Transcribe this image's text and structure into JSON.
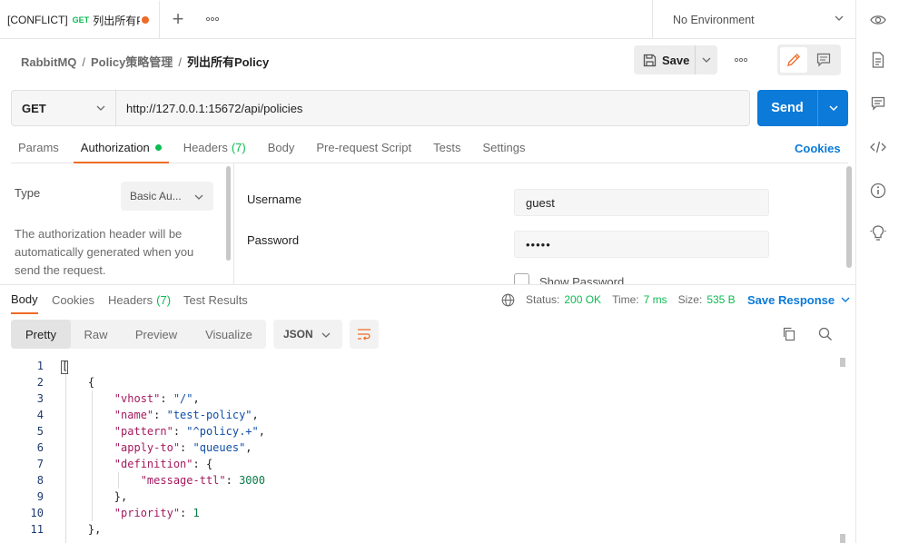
{
  "tab": {
    "name": "[CONFLICT]",
    "method": "GET",
    "title": "列出所有Policy",
    "new_tab_symbol": "+",
    "more_symbol": "ooo"
  },
  "environment": {
    "selected": "No Environment"
  },
  "breadcrumb": {
    "items": [
      "RabbitMQ",
      "Policy策略管理"
    ],
    "current": "列出所有Policy",
    "separator": "/"
  },
  "toolbar": {
    "save_label": "Save",
    "more_symbol": "ooo"
  },
  "request": {
    "method": "GET",
    "url": "http://127.0.0.1:15672/api/policies",
    "send_label": "Send"
  },
  "request_tabs": {
    "params": "Params",
    "authorization": "Authorization",
    "headers": "Headers",
    "headers_count": "(7)",
    "body": "Body",
    "prerequest": "Pre-request Script",
    "tests": "Tests",
    "settings": "Settings",
    "cookies": "Cookies"
  },
  "auth": {
    "type_label": "Type",
    "type_value": "Basic Au...",
    "description": "The authorization header will be automatically generated when you send the request.",
    "username_label": "Username",
    "username_value": "guest",
    "password_label": "Password",
    "password_value": "•••••",
    "show_password_label": "Show Password"
  },
  "response": {
    "tabs": {
      "body": "Body",
      "cookies": "Cookies",
      "headers": "Headers",
      "headers_count": "(7)",
      "test_results": "Test Results"
    },
    "status_label": "Status:",
    "status_value": "200 OK",
    "time_label": "Time:",
    "time_value": "7 ms",
    "size_label": "Size:",
    "size_value": "535 B",
    "save_response": "Save Response",
    "views": [
      "Pretty",
      "Raw",
      "Preview",
      "Visualize"
    ],
    "active_view": "Pretty",
    "format": "JSON"
  },
  "code_lines": [
    {
      "n": "1",
      "t": "["
    },
    {
      "n": "2",
      "t": "    {"
    },
    {
      "n": "3",
      "k": "        \"vhost\"",
      "v": "\"/\"",
      "vt": "s",
      "e": ","
    },
    {
      "n": "4",
      "k": "        \"name\"",
      "v": "\"test-policy\"",
      "vt": "s",
      "e": ","
    },
    {
      "n": "5",
      "k": "        \"pattern\"",
      "v": "\"^policy.+\"",
      "vt": "s",
      "e": ","
    },
    {
      "n": "6",
      "k": "        \"apply-to\"",
      "v": "\"queues\"",
      "vt": "s",
      "e": ","
    },
    {
      "n": "7",
      "k": "        \"definition\"",
      "v": "{",
      "vt": "p",
      "e": ""
    },
    {
      "n": "8",
      "k": "            \"message-ttl\"",
      "v": "3000",
      "vt": "n",
      "e": ""
    },
    {
      "n": "9",
      "t": "        },"
    },
    {
      "n": "10",
      "k": "        \"priority\"",
      "v": "1",
      "vt": "n",
      "e": ""
    },
    {
      "n": "11",
      "t": "    },"
    }
  ],
  "colors": {
    "accent": "#ef6b25",
    "primary": "#0b7ad9",
    "success": "#0cbb52"
  }
}
